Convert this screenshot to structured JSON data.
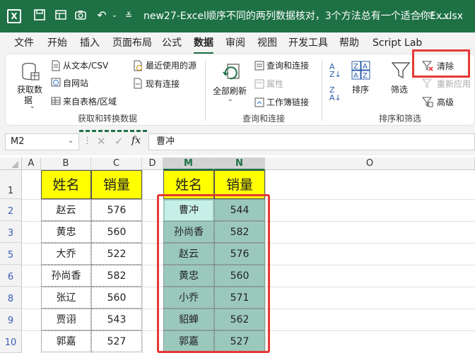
{
  "titlebar": {
    "filename": "new27-Excel顺序不同的两列数据核对，3个方法总有一个适合你！.xlsx",
    "separator": "-",
    "app": "Ex..."
  },
  "menu": [
    "文件",
    "开始",
    "插入",
    "页面布局",
    "公式",
    "数据",
    "审阅",
    "视图",
    "开发工具",
    "帮助",
    "Script Lab"
  ],
  "active_menu": "数据",
  "ribbon": {
    "get_data": "获取数\n据",
    "get_data_line1": "获取数",
    "get_data_line2": "据",
    "from_text_csv": "从文本/CSV",
    "from_web": "自网站",
    "from_table": "来自表格/区域",
    "recent_sources": "最近使用的源",
    "existing_connections": "现有连接",
    "group1": "获取和转换数据",
    "refresh_all": "全部刷新",
    "queries_connections": "查询和连接",
    "properties": "属性",
    "workbook_links": "工作簿链接",
    "group2": "查询和连接",
    "sort": "排序",
    "filter": "筛选",
    "clear": "清除",
    "reapply": "重新应用",
    "advanced": "高级",
    "group3": "排序和筛选"
  },
  "formula_bar": {
    "namebox": "M2",
    "fx": "fx",
    "value": "曹冲"
  },
  "columns": [
    "A",
    "B",
    "C",
    "D",
    "M",
    "N",
    "O"
  ],
  "selected_columns": [
    "M",
    "N"
  ],
  "row_numbers": [
    "1",
    "2",
    "3",
    "5",
    "6",
    "8",
    "9",
    "10"
  ],
  "left_table": {
    "headers": [
      "姓名",
      "销量"
    ],
    "rows": [
      [
        "赵云",
        "576"
      ],
      [
        "黄忠",
        "560"
      ],
      [
        "大乔",
        "522"
      ],
      [
        "孙尚香",
        "582"
      ],
      [
        "张辽",
        "560"
      ],
      [
        "贾诩",
        "543"
      ],
      [
        "郭嘉",
        "527"
      ]
    ]
  },
  "right_table": {
    "headers": [
      "姓名",
      "销量"
    ],
    "rows": [
      [
        "曹冲",
        "544"
      ],
      [
        "孙尚香",
        "582"
      ],
      [
        "赵云",
        "576"
      ],
      [
        "黄忠",
        "560"
      ],
      [
        "小乔",
        "571"
      ],
      [
        "貂蝉",
        "562"
      ],
      [
        "郭嘉",
        "527"
      ]
    ]
  },
  "colors": {
    "excel_green": "#1e7145",
    "header_yellow": "#ffff00",
    "selection_fill": "#9bc8bd",
    "active_cell_fill": "#c6efe7",
    "highlight_red": "#e53935"
  }
}
